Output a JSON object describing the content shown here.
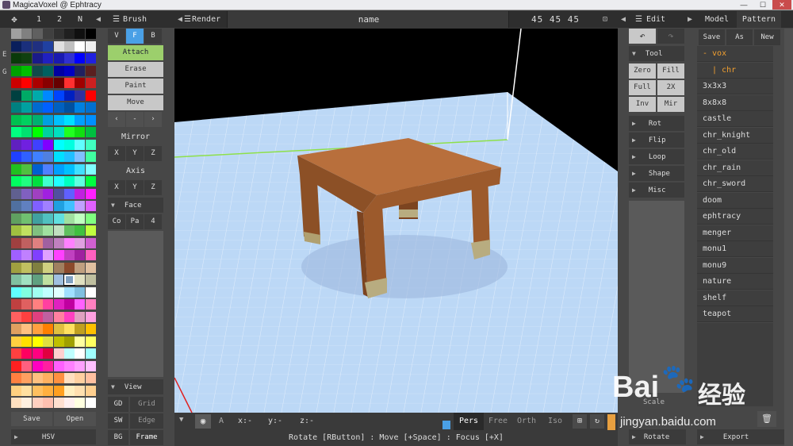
{
  "window": {
    "title": "MagicaVoxel @ Ephtracy"
  },
  "top_left_tabs": [
    "1",
    "2",
    "N"
  ],
  "side_letters": [
    "E",
    "G"
  ],
  "palette": {
    "colors": [
      "#a0a0a0",
      "#808080",
      "#606060",
      "#404040",
      "#303030",
      "#202020",
      "#101010",
      "#000000",
      "#0a1f5c",
      "#1a2f7c",
      "#203080",
      "#2040a0",
      "#e0e0e0",
      "#c0c0c0",
      "#ffffff",
      "#f0f0f0",
      "#0a3a0a",
      "#104010",
      "#1a1a8a",
      "#2020c0",
      "#1a1ab0",
      "#3030d0",
      "#0000ff",
      "#2020e0",
      "#00a000",
      "#00c000",
      "#104a4a",
      "#006060",
      "#0000a0",
      "#0000c0",
      "#202060",
      "#5a2020",
      "#cc0000",
      "#ff0000",
      "#aa0000",
      "#880000",
      "#660000",
      "#ff3030",
      "#a00000",
      "#cc2020",
      "#004040",
      "#00aa66",
      "#00aaaa",
      "#0088ff",
      "#0044ff",
      "#0020c0",
      "#3030a0",
      "#ff0000",
      "#008080",
      "#00a0a0",
      "#006ad0",
      "#0060ff",
      "#0060c0",
      "#0050a0",
      "#0080e0",
      "#0070d0",
      "#00c050",
      "#00d060",
      "#00b070",
      "#00a0e0",
      "#00c0ff",
      "#00e0ff",
      "#00a0ff",
      "#0090ff",
      "#00ff80",
      "#00e070",
      "#00ff00",
      "#00d0a0",
      "#00e0c0",
      "#20ff20",
      "#10e010",
      "#00c040",
      "#6020c0",
      "#7020e0",
      "#4040ff",
      "#8000ff",
      "#00ffff",
      "#00ffe0",
      "#60ffff",
      "#40ffc0",
      "#2040ff",
      "#3060ff",
      "#4080ff",
      "#5080e0",
      "#00e0ff",
      "#20c0ff",
      "#80c0ff",
      "#40ffa0",
      "#20c020",
      "#50c040",
      "#0060d0",
      "#5080ff",
      "#00a0ff",
      "#00c0ff",
      "#40e0ff",
      "#80ffff",
      "#00ff60",
      "#20ff80",
      "#00e040",
      "#40ffd0",
      "#20ffff",
      "#00ffc0",
      "#60ffe0",
      "#00ff40",
      "#606090",
      "#8060c0",
      "#a040c0",
      "#a020e0",
      "#5050a0",
      "#6060ff",
      "#c020e0",
      "#ff20ff",
      "#5070a0",
      "#6080c0",
      "#8060ff",
      "#a080ff",
      "#20a0e0",
      "#40c0ff",
      "#c0a0ff",
      "#e060ff",
      "#60a060",
      "#70c070",
      "#40a0a0",
      "#50c0c0",
      "#60e0e0",
      "#a0e0a0",
      "#c0ffc0",
      "#80ff80",
      "#a0c040",
      "#c0e060",
      "#80c080",
      "#a0e0a0",
      "#c0e0c0",
      "#60c060",
      "#40c040",
      "#c0ff40",
      "#a04040",
      "#c06060",
      "#e08080",
      "#a060a0",
      "#c080c0",
      "#ff80ff",
      "#e0a0e0",
      "#d060d0",
      "#a060ff",
      "#c080ff",
      "#8040ff",
      "#e0a0ff",
      "#ff40ff",
      "#c040c0",
      "#a020a0",
      "#ff60c0",
      "#a0a040",
      "#c0c060",
      "#808040",
      "#d0d080",
      "#a08060",
      "#8b4a2c",
      "#c0a080",
      "#e0c0a0",
      "#80c0a0",
      "#a0e0c0",
      "#60a080",
      "#c0e0a0",
      "#a0c0e0",
      "#80a0c0",
      "#e0e0c0",
      "#c0c0a0",
      "#60ffff",
      "#80ffe0",
      "#a0fff0",
      "#c0ffff",
      "#e0ffff",
      "#a0e0ff",
      "#80c0e0",
      "#ffffff",
      "#c04040",
      "#e06060",
      "#ff8080",
      "#ff40a0",
      "#e020c0",
      "#c000a0",
      "#ff60ff",
      "#ff80c0",
      "#ff6060",
      "#ff4040",
      "#e04080",
      "#c060a0",
      "#ff80a0",
      "#ff40c0",
      "#e0a0c0",
      "#ffa0e0",
      "#e0a060",
      "#ffc080",
      "#ffa040",
      "#ff8000",
      "#e0c040",
      "#ffe060",
      "#c0a020",
      "#ffc000",
      "#ffd040",
      "#ffe000",
      "#ffff00",
      "#e0e040",
      "#c0c000",
      "#a0a000",
      "#ffffa0",
      "#ffff60",
      "#ff4040",
      "#ff0060",
      "#ff0080",
      "#e00040",
      "#ffd0d0",
      "#c0ffff",
      "#ffffff",
      "#a0ffff",
      "#ff2020",
      "#ff6080",
      "#ff00c0",
      "#ff20a0",
      "#ff60ff",
      "#ff80ff",
      "#ffa0ff",
      "#ffc0ff",
      "#ff8040",
      "#ffa060",
      "#ffc080",
      "#ffb060",
      "#ff9040",
      "#ffe0c0",
      "#ffd0a0",
      "#ffc0a0",
      "#ffd080",
      "#ffe0a0",
      "#ffc060",
      "#ffb040",
      "#ffa020",
      "#fff0c0",
      "#ffe0b0",
      "#ffd090",
      "#ffe0c0",
      "#fff0e0",
      "#ffd0c0",
      "#ffc0b0",
      "#ffe0d0",
      "#fff0f0",
      "#ffffe0",
      "#ffffff"
    ],
    "selected_index": 165,
    "save_label": "Save",
    "open_label": "Open",
    "hsv_label": "HSV"
  },
  "brush": {
    "header": "Brush",
    "modes": [
      "V",
      "F",
      "B"
    ],
    "active_mode": "F",
    "actions": [
      "Attach",
      "Erase",
      "Paint",
      "Move"
    ],
    "nav": [
      "‹",
      "-",
      "›"
    ],
    "mirror_label": "Mirror",
    "axis_label": "Axis",
    "xyz": [
      "X",
      "Y",
      "Z"
    ],
    "face_label": "Face",
    "face_buttons": [
      "Co",
      "Pa",
      "4"
    ],
    "view_label": "View",
    "view_rows": [
      [
        "GD",
        "Grid"
      ],
      [
        "SW",
        "Edge"
      ],
      [
        "BG",
        "Frame"
      ]
    ]
  },
  "render_header": {
    "label": "Render",
    "name": "name",
    "size": "45 45 45"
  },
  "viewport": {
    "coords": [
      {
        "label": "x:",
        "value": "-"
      },
      {
        "label": "y:",
        "value": "-"
      },
      {
        "label": "z:",
        "value": "-"
      }
    ],
    "camera_modes": [
      "Pers",
      "Free",
      "Orth",
      "Iso"
    ],
    "active_camera": "Pers",
    "hint": "Rotate [RButton] : Move [+Space] : Focus [+X]"
  },
  "edit": {
    "header": "Edit",
    "tool_label": "Tool",
    "tool_buttons": [
      [
        "Zero",
        "Fill"
      ],
      [
        "Full",
        "2X"
      ],
      [
        "Inv",
        "Mir"
      ]
    ],
    "sections": [
      "Rot",
      "Flip",
      "Loop",
      "Shape",
      "Misc"
    ],
    "bottom_section": "Rotate",
    "partial_label": "Scale"
  },
  "model": {
    "tabs": [
      "Model",
      "Pattern"
    ],
    "active_tab": "Pattern",
    "actions": [
      "Save",
      "As",
      "New"
    ],
    "tree": [
      {
        "label": "- vox",
        "accent": true
      },
      {
        "label": "  | chr",
        "accent": true
      }
    ],
    "items": [
      "3x3x3",
      "8x8x8",
      "castle",
      "chr_knight",
      "chr_old",
      "chr_rain",
      "chr_sword",
      "doom",
      "ephtracy",
      "menger",
      "monu1",
      "monu9",
      "nature",
      "shelf",
      "teapot"
    ],
    "export_label": "Export"
  },
  "watermark": {
    "brand": "Bai",
    "brand2": "经验",
    "url": "jingyan.baidu.com"
  },
  "colors": {
    "accent": "#9ccf6c",
    "active_blue": "#4aa0e6",
    "orange": "#e8a040",
    "sky": "#bcd8f6"
  }
}
